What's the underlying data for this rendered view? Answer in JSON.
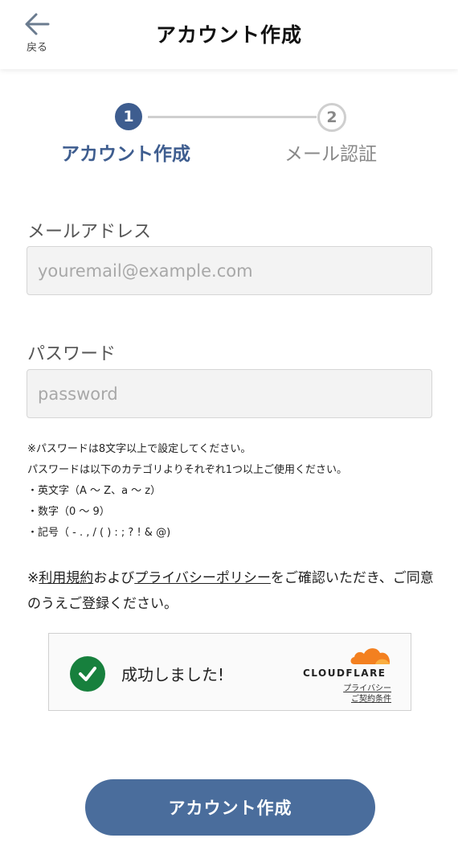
{
  "header": {
    "back_label": "戻る",
    "title": "アカウント作成"
  },
  "stepper": {
    "steps": [
      {
        "number": "1",
        "label": "アカウント作成",
        "state": "active"
      },
      {
        "number": "2",
        "label": "メール認証",
        "state": "inactive"
      }
    ]
  },
  "form": {
    "email": {
      "label": "メールアドレス",
      "placeholder": "youremail@example.com",
      "value": ""
    },
    "password": {
      "label": "パスワード",
      "placeholder": "password",
      "value": ""
    },
    "password_notes": [
      "※パスワードは8文字以上で設定してください。",
      "パスワードは以下のカテゴリよりそれぞれ1つ以上ご使用ください。",
      "・英文字（A ～ Z、a ～ z）",
      "・数字（0 ～ 9）",
      "・記号（ - . , / ( ) : ; ? ! & @)"
    ],
    "terms": {
      "prefix": "※",
      "terms_link": "利用規約",
      "middle": "および",
      "privacy_link": "プライバシーポリシー",
      "suffix": "をご確認いただき、ご同意のうえご登録ください。"
    }
  },
  "turnstile": {
    "status": "成功しました!",
    "brand": "CLOUDFLARE",
    "privacy_link": "プライバシー",
    "terms_link": "ご契約条件"
  },
  "submit": {
    "label": "アカウント作成"
  },
  "colors": {
    "primary": "#3e5d8f",
    "button": "#4a6d9c",
    "success": "#17803d",
    "cloudflare": "#f38020"
  }
}
